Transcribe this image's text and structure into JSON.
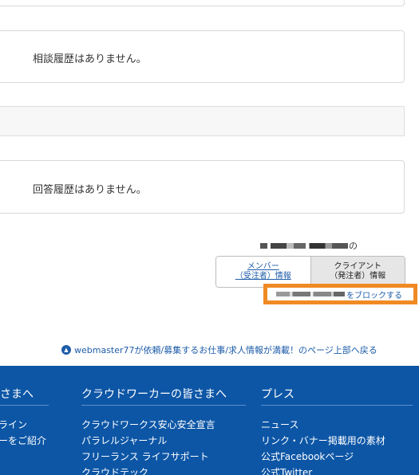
{
  "history": {
    "consultation_empty": "相談履歴はありません。",
    "answer_empty": "回答履歴はありません。"
  },
  "profile_toggle": {
    "user_suffix": "の",
    "member_line1": "メンバー",
    "member_line2": "（受注者）情報",
    "client_line1": "クライアント",
    "client_line2": "（発注者）情報"
  },
  "block": {
    "label": "をブロックする"
  },
  "page_top": {
    "text": "webmaster77が依頼/募集するお仕事/求人情報が満載！のページ上部へ戻る"
  },
  "footer": {
    "col0": {
      "heading": "皆さまへ",
      "items": [
        "",
        "ンライン",
        "ナーをご紹介"
      ]
    },
    "col1": {
      "heading": "クラウドワーカーの皆さまへ",
      "items": [
        "クラウドワークス安心安全宣言",
        "パラレルジャーナル",
        "フリーランス ライフサポート",
        "クラウドテック"
      ]
    },
    "col2": {
      "heading": "プレス",
      "items": [
        "ニュース",
        "リンク・バナー掲載用の素材",
        "公式Facebookページ",
        "公式Twitter"
      ]
    }
  },
  "colors": {
    "footer_bg": "#0d56a6",
    "link": "#1d5ca8",
    "highlight_border": "#f08a24"
  }
}
